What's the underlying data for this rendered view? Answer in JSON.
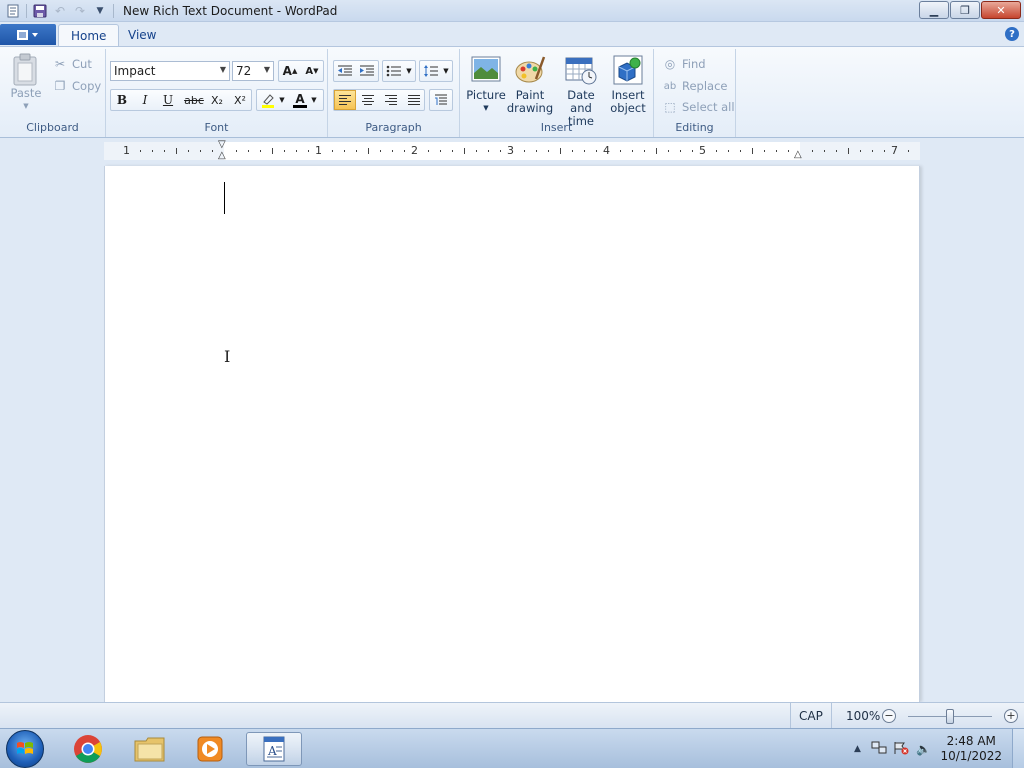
{
  "window": {
    "title": "New Rich Text Document - WordPad",
    "controls": {
      "minimize": "▁",
      "maximize": "❐",
      "close": "✕"
    }
  },
  "tabs": {
    "app_menu_icon": "app-menu-icon",
    "home": "Home",
    "view": "View",
    "help": "?"
  },
  "ribbon": {
    "clipboard": {
      "label": "Clipboard",
      "paste": "Paste",
      "cut": "Cut",
      "copy": "Copy"
    },
    "font": {
      "label": "Font",
      "family": "Impact",
      "size": "72",
      "bold": "B",
      "italic": "I",
      "underline": "U",
      "strike": "abc",
      "subscript": "X₂",
      "superscript": "X²"
    },
    "paragraph": {
      "label": "Paragraph"
    },
    "insert": {
      "label": "Insert",
      "picture": "Picture",
      "paint_line1": "Paint",
      "paint_line2": "drawing",
      "datetime_line1": "Date and",
      "datetime_line2": "time",
      "object_line1": "Insert",
      "object_line2": "object"
    },
    "editing": {
      "label": "Editing",
      "find": "Find",
      "replace": "Replace",
      "select_all": "Select all"
    }
  },
  "ruler": {
    "numbers": [
      "1",
      "1",
      "2",
      "3",
      "4",
      "5",
      "7"
    ]
  },
  "status": {
    "cap": "CAP",
    "zoom": "100%",
    "zoom_out": "−",
    "zoom_in": "+"
  },
  "taskbar": {
    "time": "2:48 AM",
    "date": "10/1/2022"
  },
  "colors": {
    "accent": "#1f56a8",
    "highlight": "#f6c354",
    "font_color": "#000000",
    "highlight_marker": "#ffff00"
  }
}
